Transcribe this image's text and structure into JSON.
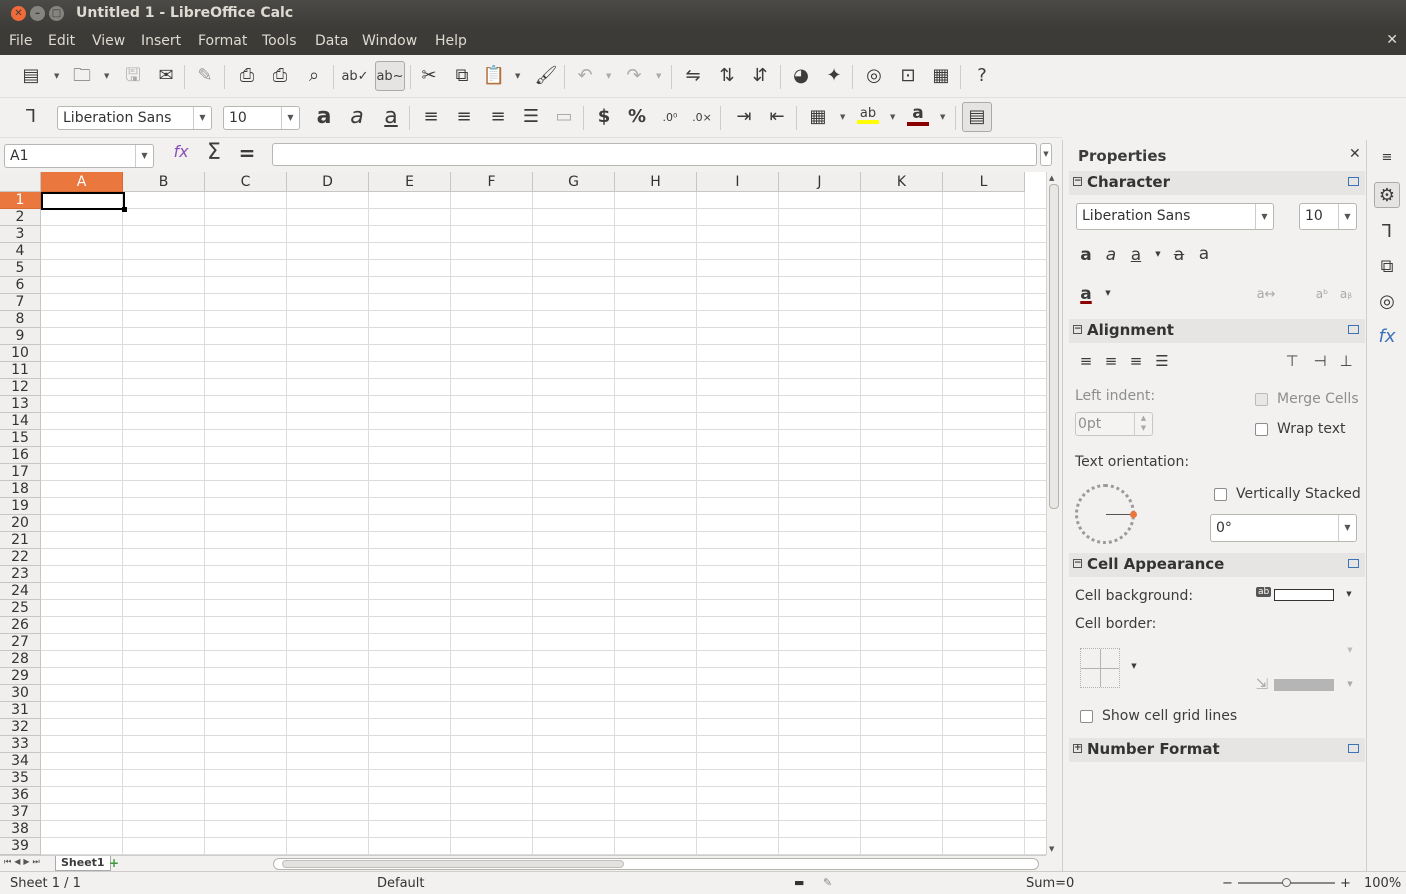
{
  "window": {
    "title": "Untitled 1 - LibreOffice Calc"
  },
  "menu": [
    "File",
    "Edit",
    "View",
    "Insert",
    "Format",
    "Tools",
    "Data",
    "Window",
    "Help"
  ],
  "formatting": {
    "font_name": "Liberation Sans",
    "font_size": "10"
  },
  "formula_bar": {
    "name_box": "A1",
    "content": ""
  },
  "grid": {
    "columns": [
      "A",
      "B",
      "C",
      "D",
      "E",
      "F",
      "G",
      "H",
      "I",
      "J",
      "K",
      "L"
    ],
    "rows": [
      "1",
      "2",
      "3",
      "4",
      "5",
      "6",
      "7",
      "8",
      "9",
      "10",
      "11",
      "12",
      "13",
      "14",
      "15",
      "16",
      "17",
      "18",
      "19",
      "20",
      "21",
      "22",
      "23",
      "24",
      "25",
      "26",
      "27",
      "28",
      "29",
      "30",
      "31",
      "32",
      "33",
      "34",
      "35",
      "36",
      "37",
      "38",
      "39"
    ],
    "selected_cell": "A1"
  },
  "sheet_tabs": [
    "Sheet1"
  ],
  "status": {
    "sheet": "Sheet 1 / 1",
    "style": "Default",
    "sum": "Sum=0",
    "zoom": "100%"
  },
  "sidebar": {
    "title": "Properties",
    "character": {
      "title": "Character",
      "font_name": "Liberation Sans",
      "font_size": "10"
    },
    "alignment": {
      "title": "Alignment",
      "left_indent_label": "Left indent:",
      "left_indent_value": "0pt",
      "merge_cells": "Merge Cells",
      "wrap_text": "Wrap text",
      "text_orientation_label": "Text orientation:",
      "vertically_stacked": "Vertically Stacked",
      "angle": "0°"
    },
    "cell_appearance": {
      "title": "Cell Appearance",
      "cell_background_label": "Cell background:",
      "cell_border_label": "Cell border:",
      "show_grid_lines": "Show cell grid lines"
    },
    "number_format": {
      "title": "Number Format"
    }
  },
  "colors": {
    "accent": "#e9773e",
    "titlebar": "#3c3b37",
    "font_color": "#8b0000",
    "highlight": "#ffff00"
  }
}
